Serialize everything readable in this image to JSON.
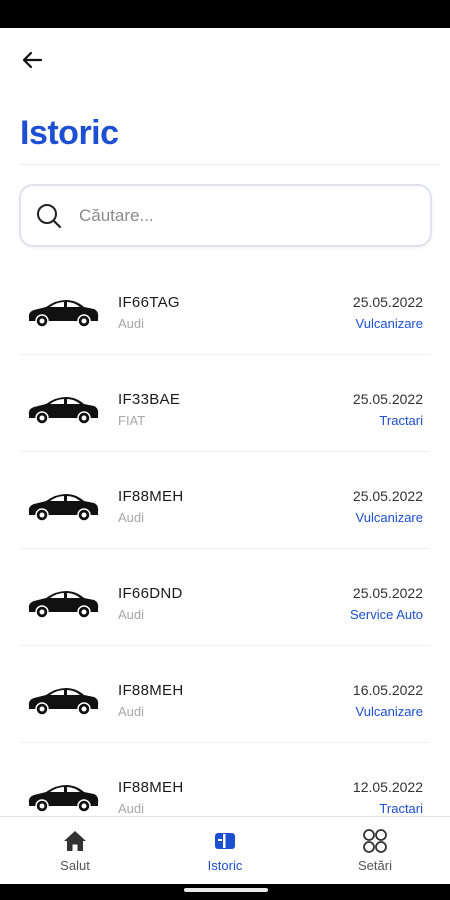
{
  "header": {
    "back_icon": "arrow-left-icon",
    "title": "Istoric"
  },
  "search": {
    "placeholder": "Căutare...",
    "icon": "search-icon"
  },
  "history": [
    {
      "plate": "IF66TAG",
      "brand": "Audi",
      "date": "25.05.2022",
      "service": "Vulcanizare"
    },
    {
      "plate": "IF33BAE",
      "brand": "FIAT",
      "date": "25.05.2022",
      "service": "Tractari"
    },
    {
      "plate": "IF88MEH",
      "brand": "Audi",
      "date": "25.05.2022",
      "service": "Vulcanizare"
    },
    {
      "plate": "IF66DND",
      "brand": "Audi",
      "date": "25.05.2022",
      "service": "Service Auto"
    },
    {
      "plate": "IF88MEH",
      "brand": "Audi",
      "date": "16.05.2022",
      "service": "Vulcanizare"
    },
    {
      "plate": "IF88MEH",
      "brand": "Audi",
      "date": "12.05.2022",
      "service": "Tractari"
    }
  ],
  "bottom_nav": [
    {
      "label": "Salut",
      "icon": "home-icon",
      "active": false
    },
    {
      "label": "Istoric",
      "icon": "history-icon",
      "active": true
    },
    {
      "label": "Setări",
      "icon": "settings-grid-icon",
      "active": false
    }
  ],
  "colors": {
    "accent": "#1c4fd1",
    "secondary_text": "#a7a7a7",
    "divider": "#efefef"
  }
}
